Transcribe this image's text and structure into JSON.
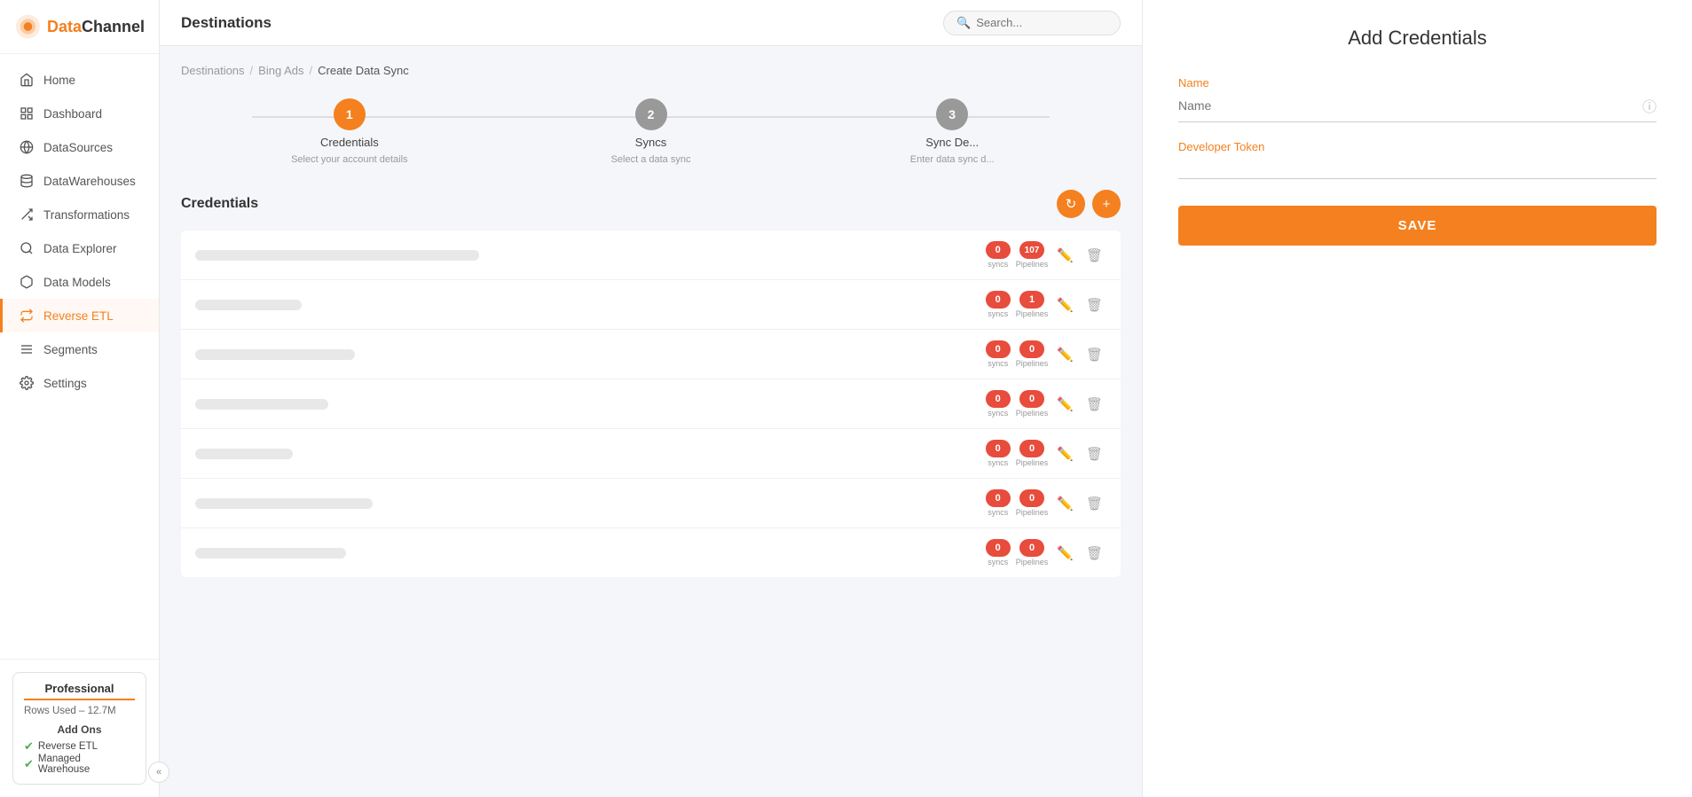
{
  "app": {
    "name": "DataChannel",
    "logo_text_orange": "Data",
    "logo_text_dark": "Channel"
  },
  "sidebar": {
    "nav_items": [
      {
        "id": "home",
        "label": "Home",
        "icon": "home"
      },
      {
        "id": "dashboard",
        "label": "Dashboard",
        "icon": "dashboard"
      },
      {
        "id": "datasources",
        "label": "DataSources",
        "icon": "datasources"
      },
      {
        "id": "datawarehouses",
        "label": "DataWarehouses",
        "icon": "datawarehouses"
      },
      {
        "id": "transformations",
        "label": "Transformations",
        "icon": "transformations"
      },
      {
        "id": "data-explorer",
        "label": "Data Explorer",
        "icon": "data-explorer"
      },
      {
        "id": "data-models",
        "label": "Data Models",
        "icon": "data-models"
      },
      {
        "id": "reverse-etl",
        "label": "Reverse ETL",
        "icon": "reverse-etl",
        "active": true
      },
      {
        "id": "segments",
        "label": "Segments",
        "icon": "segments"
      },
      {
        "id": "settings",
        "label": "Settings",
        "icon": "settings"
      }
    ],
    "plan": {
      "title": "Professional",
      "rows_used": "Rows Used – 12.7M",
      "addons_label": "Add Ons",
      "addons": [
        {
          "label": "Reverse ETL",
          "checked": true
        },
        {
          "label": "Managed Warehouse",
          "checked": true
        }
      ]
    },
    "collapse_label": "«"
  },
  "header": {
    "title": "Destinations",
    "search_placeholder": "Search..."
  },
  "breadcrumb": {
    "items": [
      "Destinations",
      "Bing Ads",
      "Create Data Sync"
    ]
  },
  "stepper": {
    "steps": [
      {
        "number": "1",
        "label": "Credentials",
        "sublabel": "Select your account details",
        "active": true
      },
      {
        "number": "2",
        "label": "Syncs",
        "sublabel": "Select a data sync",
        "active": false
      },
      {
        "number": "3",
        "label": "Sync De...",
        "sublabel": "Enter data sync d...",
        "active": false
      }
    ]
  },
  "credentials_section": {
    "title": "Credentials",
    "refresh_label": "↻",
    "add_label": "+",
    "rows": [
      {
        "syncs": "0",
        "pipelines": "107"
      },
      {
        "syncs": "0",
        "pipelines": "1"
      },
      {
        "syncs": "0",
        "pipelines": "0"
      },
      {
        "syncs": "0",
        "pipelines": "0"
      },
      {
        "syncs": "0",
        "pipelines": "0"
      },
      {
        "syncs": "0",
        "pipelines": "0"
      },
      {
        "syncs": "0",
        "pipelines": "0"
      }
    ],
    "badge_labels": {
      "syncs": "syncs",
      "pipelines": "Pipelines"
    }
  },
  "add_credentials_panel": {
    "title": "Add Credentials",
    "name_label": "Name",
    "name_placeholder": "Name",
    "developer_token_label": "Developer Token",
    "developer_token_placeholder": "",
    "save_label": "SAVE"
  }
}
